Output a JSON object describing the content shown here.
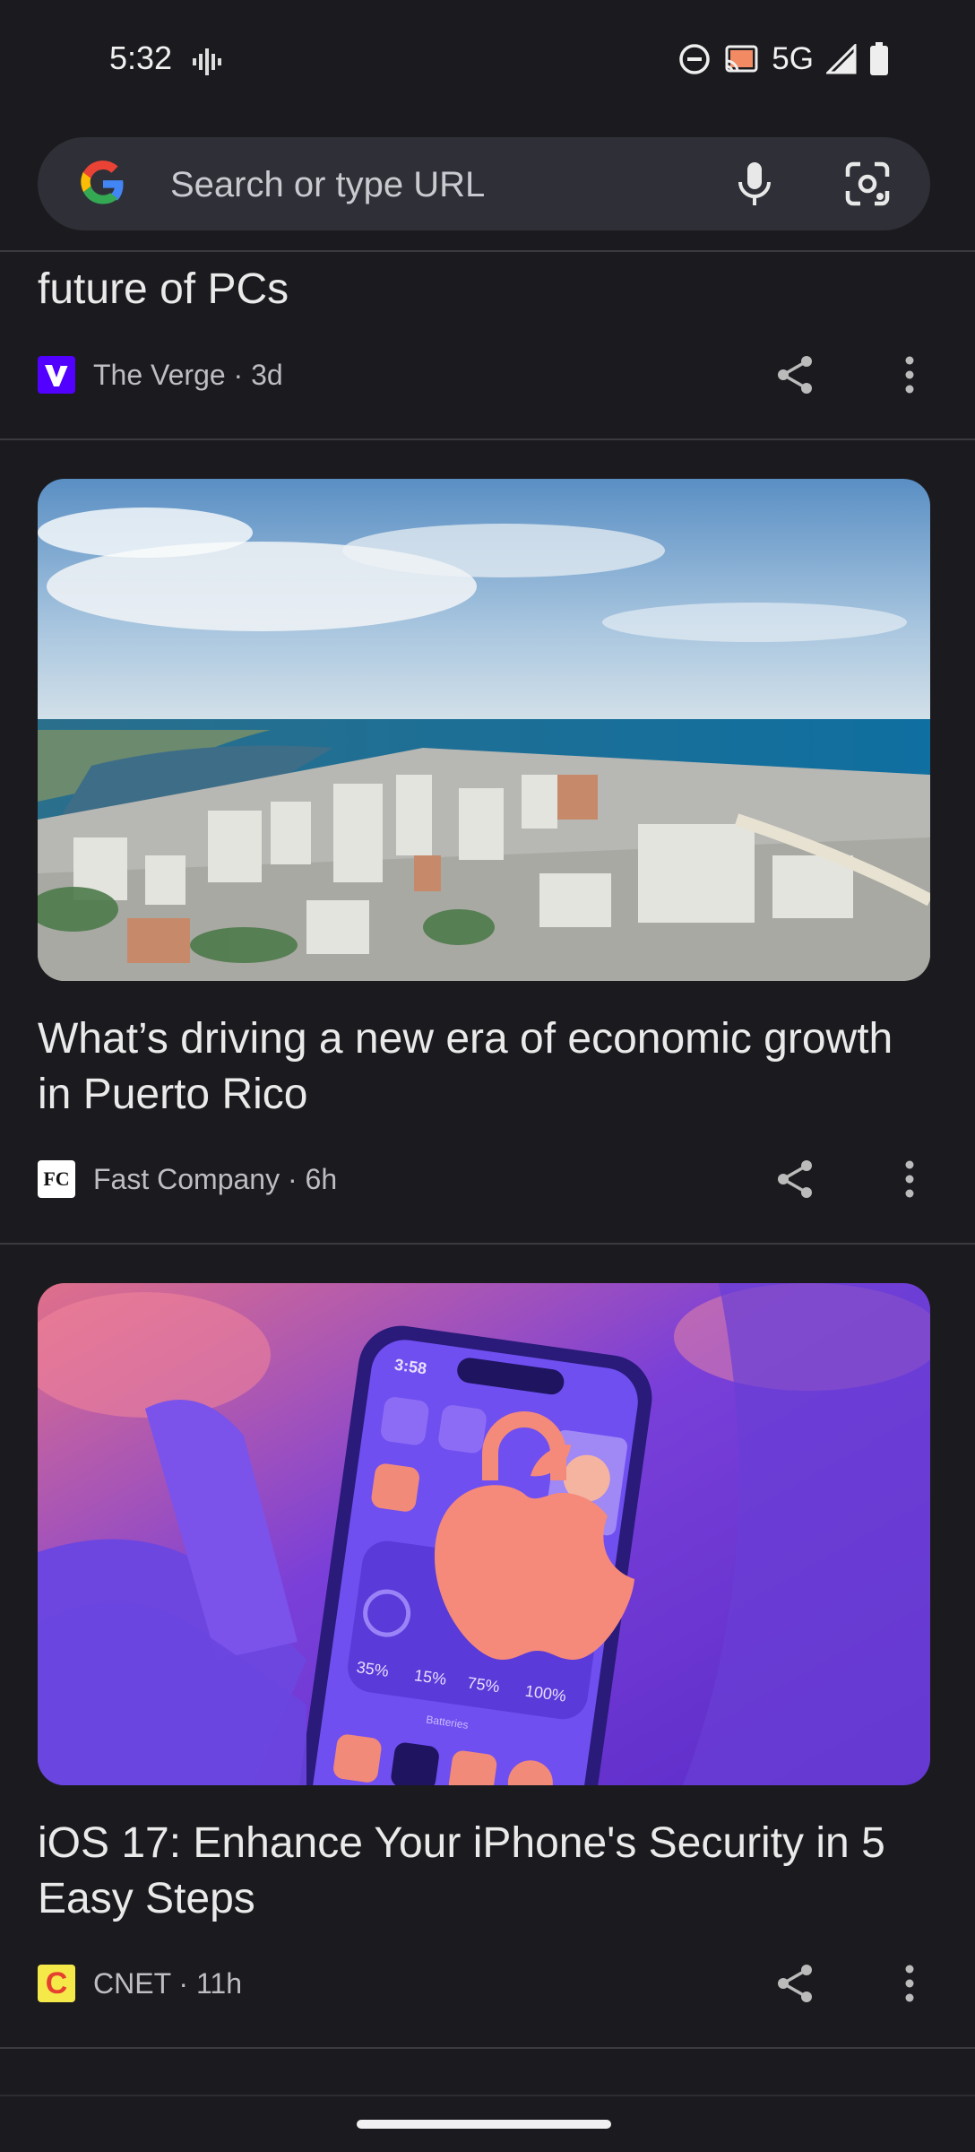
{
  "status": {
    "time": "5:32",
    "network": "5G"
  },
  "search": {
    "placeholder": "Search or type URL"
  },
  "articles": [
    {
      "title": "future of PCs",
      "source": "The Verge · 3d"
    },
    {
      "title": "What’s driving a new era of economic growth in Puerto Rico",
      "source": "Fast Company · 6h",
      "source_icon": "FC"
    },
    {
      "title": "iOS 17: Enhance Your iPhone's Security in 5 Easy Steps",
      "source": "CNET · 11h",
      "source_icon": "C",
      "image_text": {
        "time": "3:58",
        "p1": "35%",
        "p2": "15%",
        "p3": "75%",
        "p4": "100%",
        "batteries": "Batteries"
      }
    }
  ],
  "colors": {
    "background": "#1b1b1f",
    "searchbar": "#2f3037",
    "verge": "#5200ff",
    "cnet": "#f5e94a"
  }
}
